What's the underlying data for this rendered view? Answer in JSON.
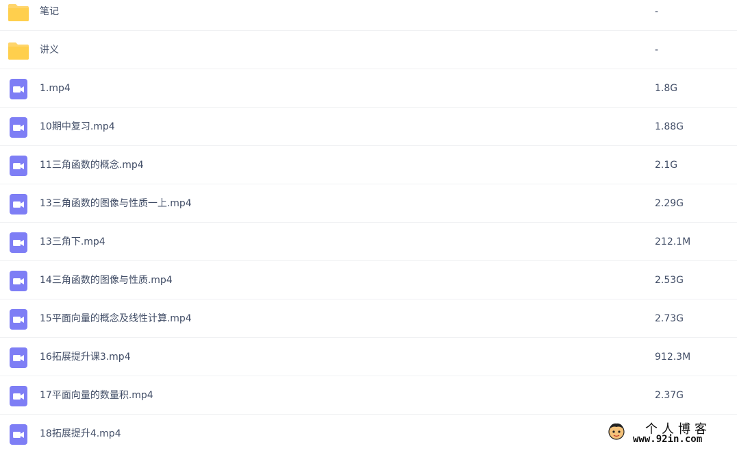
{
  "files": [
    {
      "name": "笔记",
      "size": "-",
      "type": "folder"
    },
    {
      "name": "讲义",
      "size": "-",
      "type": "folder"
    },
    {
      "name": "1.mp4",
      "size": "1.8G",
      "type": "video"
    },
    {
      "name": "10期中复习.mp4",
      "size": "1.88G",
      "type": "video"
    },
    {
      "name": "11三角函数的概念.mp4",
      "size": "2.1G",
      "type": "video"
    },
    {
      "name": "13三角函数的图像与性质一上.mp4",
      "size": "2.29G",
      "type": "video"
    },
    {
      "name": "13三角下.mp4",
      "size": "212.1M",
      "type": "video"
    },
    {
      "name": "14三角函数的图像与性质.mp4",
      "size": "2.53G",
      "type": "video"
    },
    {
      "name": "15平面向量的概念及线性计算.mp4",
      "size": "2.73G",
      "type": "video"
    },
    {
      "name": "16拓展提升课3.mp4",
      "size": "912.3M",
      "type": "video"
    },
    {
      "name": "17平面向量的数量积.mp4",
      "size": "2.37G",
      "type": "video"
    },
    {
      "name": "18拓展提升4.mp4",
      "size": "",
      "type": "video"
    }
  ],
  "icons": {
    "folder": "folder-icon",
    "video": "video-file-icon"
  },
  "colors": {
    "folder": "#ffd56b",
    "video": "#7e7ef5",
    "text": "#424e67",
    "divider": "#f0f1f3"
  },
  "watermark": {
    "title": "个人博客",
    "url": "www.92in.com"
  }
}
